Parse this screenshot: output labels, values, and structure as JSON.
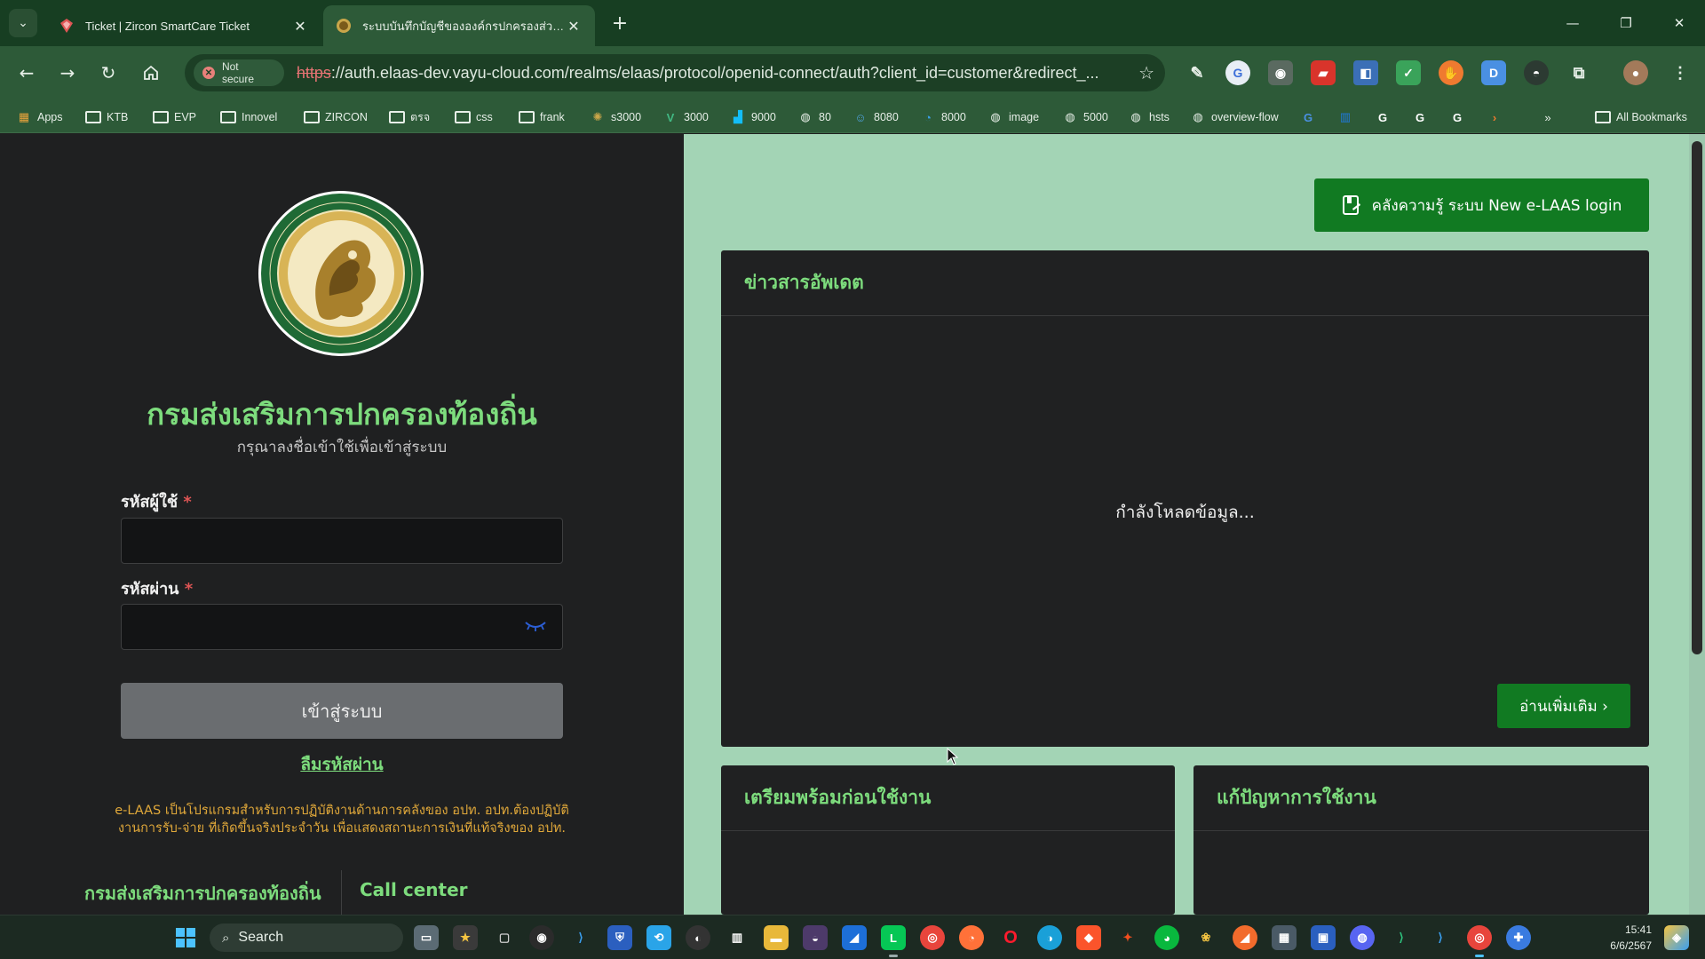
{
  "browser": {
    "tabs": [
      {
        "title": "Ticket | Zircon SmartCare Ticket",
        "active": false
      },
      {
        "title": "ระบบบันทึกบัญชีขององค์กรปกครองส่วนท้องถิ่น (e-LAAS)",
        "active": true
      }
    ],
    "security_label": "Not secure",
    "url_protocol": "https",
    "url_rest": "://auth.elaas-dev.vayu-cloud.com/realms/elaas/protocol/openid-connect/auth?client_id=customer&redirect_...",
    "bookmarks": [
      "Apps",
      "KTB",
      "EVP",
      "Innovel",
      "ZIRCON",
      "ตรจ",
      "css",
      "frank",
      "s3000",
      "3000",
      "9000",
      "80",
      "8080",
      "8000",
      "image",
      "5000",
      "hsts",
      "overview-flow"
    ],
    "all_bookmarks_label": "All Bookmarks"
  },
  "login": {
    "org_title": "กรมส่งเสริมการปกครองท้องถิ่น",
    "subtitle": "กรุณาลงชื่อเข้าใช้เพื่อเข้าสู่ระบบ",
    "username_label": "รหัสผู้ใช้",
    "password_label": "รหัสผ่าน",
    "required_mark": "*",
    "username_value": "",
    "password_value": "",
    "submit_label": "เข้าสู่ระบบ",
    "forgot_label": "ลืมรหัสผ่าน",
    "description_line1": "e-LAAS เป็นโปรแกรมสำหรับการปฏิบัติงานด้านการคลังของ อปท. อปท.ต้องปฏิบัติ",
    "description_line2": "งานการรับ-จ่าย ที่เกิดขึ้นจริงประจำวัน เพื่อแสดงสถานะการเงินที่แท้จริงของ อปท.",
    "footer_org": "กรมส่งเสริมการปกครองท้องถิ่น",
    "footer_callcenter": "Call center"
  },
  "news": {
    "kb_button_label": "คลังความรู้ ระบบ New e-LAAS login",
    "news_title": "ข่าวสารอัพเดต",
    "loading_text": "กำลังโหลดข้อมูล...",
    "read_more_label": "อ่านเพิ่มเติม",
    "prepare_title": "เตรียมพร้อมก่อนใช้งาน",
    "troubleshoot_title": "แก้ปัญหาการใช้งาน"
  },
  "taskbar": {
    "search_label": "Search",
    "time": "15:41",
    "date": "6/6/2567"
  },
  "colors": {
    "accent_green": "#7ddc7d",
    "button_green": "#117a22",
    "right_bg": "#a3d4b5",
    "left_bg": "#1f2021",
    "description_color": "#e0a83a"
  }
}
